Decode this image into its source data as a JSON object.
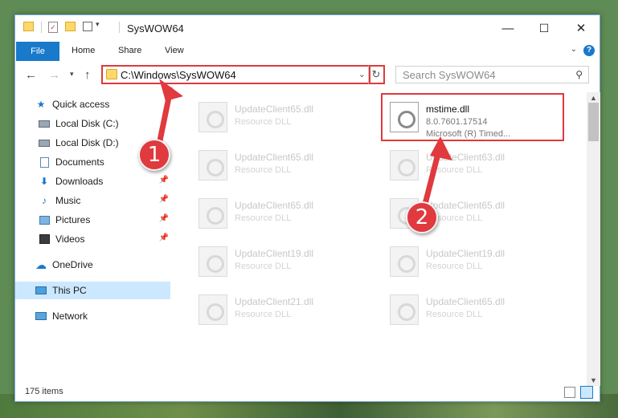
{
  "window": {
    "title": "SysWOW64",
    "minimize_glyph": "—",
    "maximize_glyph": "☐",
    "close_glyph": "✕"
  },
  "ribbon": {
    "tabs": [
      "File",
      "Home",
      "Share",
      "View"
    ],
    "help_glyph": "?"
  },
  "address": {
    "path": "C:\\Windows\\SysWOW64",
    "search_placeholder": "Search SysWOW64"
  },
  "nav_pane": {
    "items": [
      {
        "label": "Quick access",
        "icon": "star-icon"
      },
      {
        "label": "Local Disk (C:)",
        "icon": "drive-icon"
      },
      {
        "label": "Local Disk (D:)",
        "icon": "drive-icon"
      },
      {
        "label": "Documents",
        "icon": "documents-icon",
        "pinned": true
      },
      {
        "label": "Downloads",
        "icon": "downloads-icon",
        "pinned": true
      },
      {
        "label": "Music",
        "icon": "music-icon",
        "pinned": true
      },
      {
        "label": "Pictures",
        "icon": "pictures-icon",
        "pinned": true
      },
      {
        "label": "Videos",
        "icon": "videos-icon",
        "pinned": true
      },
      {
        "label": "OneDrive",
        "icon": "cloud-icon"
      },
      {
        "label": "This PC",
        "icon": "computer-icon",
        "selected": true
      },
      {
        "label": "Network",
        "icon": "network-icon"
      }
    ]
  },
  "files": {
    "selected": {
      "name": "mstime.dll",
      "version": "8.0.7601.17514",
      "description": "Microsoft (R) Timed..."
    },
    "left_column": [
      {
        "name": "UpdateClient65.dll",
        "type": "Resource DLL"
      },
      {
        "name": "UpdateClient65.dll",
        "type": "Resource DLL"
      },
      {
        "name": "UpdateClient65.dll",
        "type": "Resource DLL"
      },
      {
        "name": "UpdateClient19.dll",
        "type": "Resource DLL"
      },
      {
        "name": "UpdateClient21.dll",
        "type": "Resource DLL"
      }
    ],
    "right_column": [
      {
        "name": "UpdateClient63.dll",
        "type": "Resource DLL"
      },
      {
        "name": "UpdateClient65.dll",
        "type": "Resource DLL"
      },
      {
        "name": "UpdateClient19.dll",
        "type": "Resource DLL"
      },
      {
        "name": "UpdateClient65.dll",
        "type": "Resource DLL"
      }
    ]
  },
  "status": {
    "item_count": "175 items"
  },
  "annotations": {
    "badge_1": "1",
    "badge_2": "2",
    "highlight_color": "#e0393e"
  }
}
